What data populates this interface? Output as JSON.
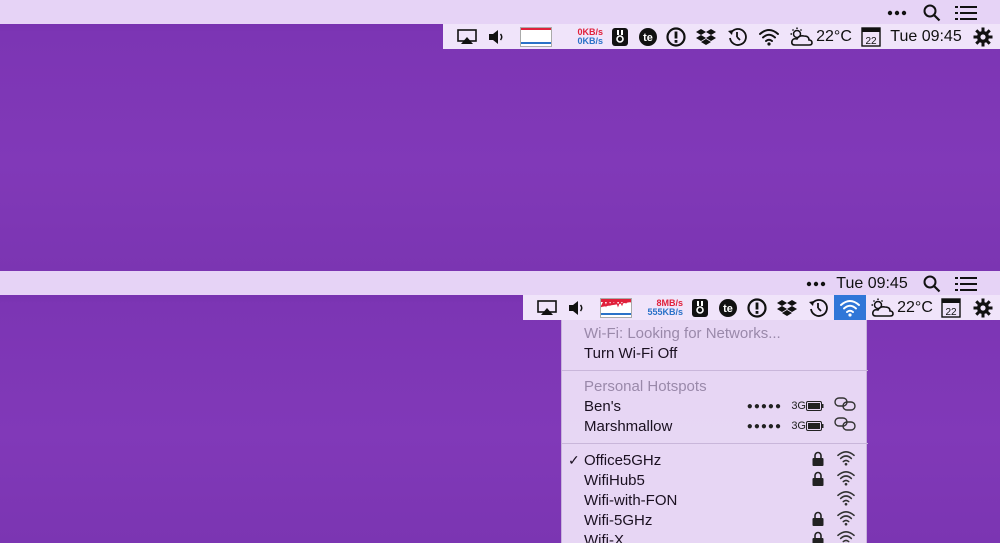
{
  "top_bar": {
    "netmon_up": "0KB/s",
    "netmon_down": "0KB/s",
    "temperature": "22°C",
    "calendar_day": "22",
    "clock": "Tue 09:45"
  },
  "bottom_bar": {
    "clock": "Tue 09:45",
    "netmon_up": "8MB/s",
    "netmon_down": "555KB/s",
    "temperature": "22°C",
    "calendar_day": "22"
  },
  "wifi_menu": {
    "status": "Wi-Fi: Looking for Networks...",
    "toggle": "Turn Wi-Fi Off",
    "hotspots_header": "Personal Hotspots",
    "hotspots": [
      {
        "name": "Ben's",
        "signal": "●●●●●",
        "network": "3G"
      },
      {
        "name": "Marshmallow",
        "signal": "●●●●●",
        "network": "3G"
      }
    ],
    "networks": [
      {
        "name": "Office5GHz",
        "connected": true,
        "locked": true
      },
      {
        "name": "WifiHub5",
        "connected": false,
        "locked": true
      },
      {
        "name": "Wifi-with-FON",
        "connected": false,
        "locked": false
      },
      {
        "name": "Wifi-5GHz",
        "connected": false,
        "locked": true
      },
      {
        "name": "Wifi-X",
        "connected": false,
        "locked": true
      }
    ],
    "check_mark": "✓"
  },
  "colors": {
    "desktop": "#7e38b6",
    "menubar": "#e6d3f6",
    "accent": "#2f77d8",
    "upload": "#e0203a",
    "download": "#2a72c8"
  },
  "icons": [
    "more-icon",
    "search-icon",
    "list-icon",
    "airplay-icon",
    "volume-icon",
    "bandwidth-graph-icon",
    "netmon-icon",
    "app-icon",
    "te-icon",
    "alert-icon",
    "dropbox-icon",
    "time-machine-icon",
    "wifi-icon",
    "weather-icon",
    "calendar-icon",
    "gear-icon",
    "lock-icon",
    "battery-icon",
    "hotspot-link-icon"
  ]
}
